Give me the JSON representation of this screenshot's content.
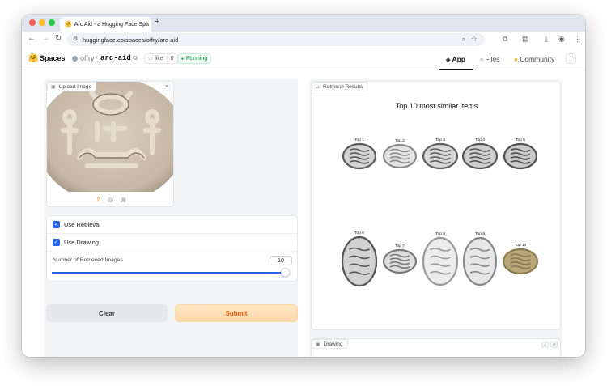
{
  "browser": {
    "tab_title": "Arc Aid - a Hugging Face Spa",
    "tab_close": "×",
    "new_tab": "+",
    "url": "huggingface.co/spaces/offry/arc-aid"
  },
  "hf": {
    "brand": "Spaces",
    "owner": "offry",
    "separator": "/",
    "repo": "arc-aid",
    "like_label": "like",
    "like_count": "0",
    "status": "Running",
    "nav": {
      "app": "App",
      "files": "Files",
      "community": "Community"
    }
  },
  "upload": {
    "label": "Upload Image",
    "close": "×"
  },
  "controls": {
    "use_retrieval": "Use Retrieval",
    "use_drawing": "Use Drawing",
    "slider_label": "Number of Retrieved Images",
    "slider_value": "10",
    "slider_fraction": 1.0
  },
  "buttons": {
    "clear": "Clear",
    "submit": "Submit"
  },
  "results": {
    "label": "Retrieval Results",
    "title": "Top 10 most similar items",
    "items": [
      "Top 1",
      "Top 2",
      "Top 3",
      "Top 4",
      "Top 5",
      "Top 6",
      "Top 7",
      "Top 8",
      "Top 9",
      "Top 10"
    ]
  },
  "drawing": {
    "label": "Drawing"
  },
  "colors": {
    "accent": "#2563eb",
    "submit_text": "#ea580c",
    "running": "#15803d"
  }
}
